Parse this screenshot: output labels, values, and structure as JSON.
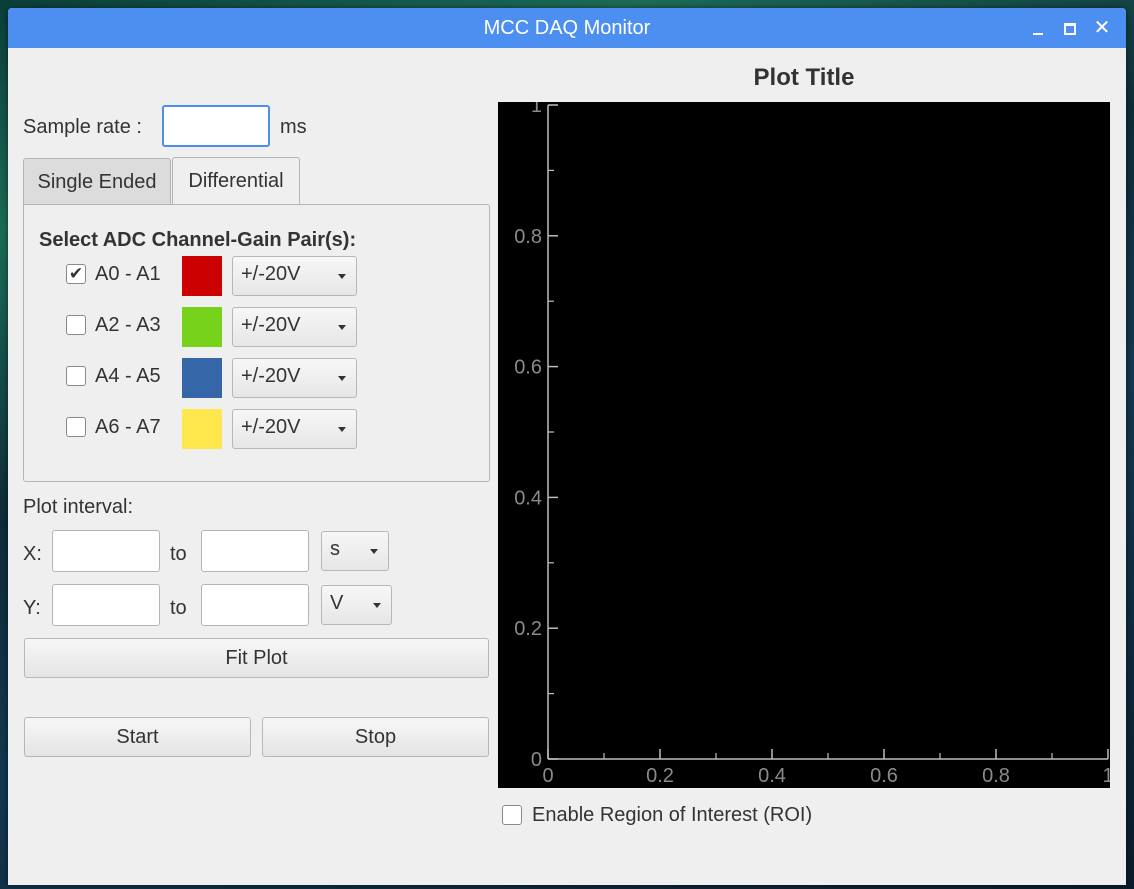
{
  "window": {
    "title": "MCC DAQ Monitor"
  },
  "sample_rate": {
    "label": "Sample rate :",
    "value": "",
    "unit": "ms"
  },
  "tabs": [
    {
      "label": "Single Ended",
      "active": false
    },
    {
      "label": "Differential",
      "active": true
    }
  ],
  "channels": {
    "heading": "Select ADC Channel-Gain Pair(s):",
    "items": [
      {
        "label": "A0 - A1",
        "checked": true,
        "color": "#cc0000",
        "gain": "+/-20V"
      },
      {
        "label": "A2 - A3",
        "checked": false,
        "color": "#76d21a",
        "gain": "+/-20V"
      },
      {
        "label": "A4 - A5",
        "checked": false,
        "color": "#3466a8",
        "gain": "+/-20V"
      },
      {
        "label": "A6 - A7",
        "checked": false,
        "color": "#fde74c",
        "gain": "+/-20V"
      }
    ]
  },
  "plot_interval": {
    "label": "Plot interval:",
    "x": {
      "label": "X:",
      "from": "",
      "to_label": "to",
      "to": "",
      "unit": "s"
    },
    "y": {
      "label": "Y:",
      "from": "",
      "to_label": "to",
      "to": "",
      "unit": "V"
    }
  },
  "buttons": {
    "fit_plot": "Fit Plot",
    "start": "Start",
    "stop": "Stop"
  },
  "roi": {
    "label": "Enable Region of Interest (ROI)",
    "checked": false
  },
  "chart_data": {
    "type": "line",
    "title": "Plot Title",
    "xlabel": "",
    "ylabel": "",
    "xlim": [
      0,
      1
    ],
    "ylim": [
      0,
      1
    ],
    "x_ticks": [
      "0",
      "0.2",
      "0.4",
      "0.6",
      "0.8",
      "1"
    ],
    "y_ticks": [
      "0",
      "0.2",
      "0.4",
      "0.6",
      "0.8",
      "1"
    ],
    "series": [],
    "grid": false,
    "background": "#000000"
  }
}
